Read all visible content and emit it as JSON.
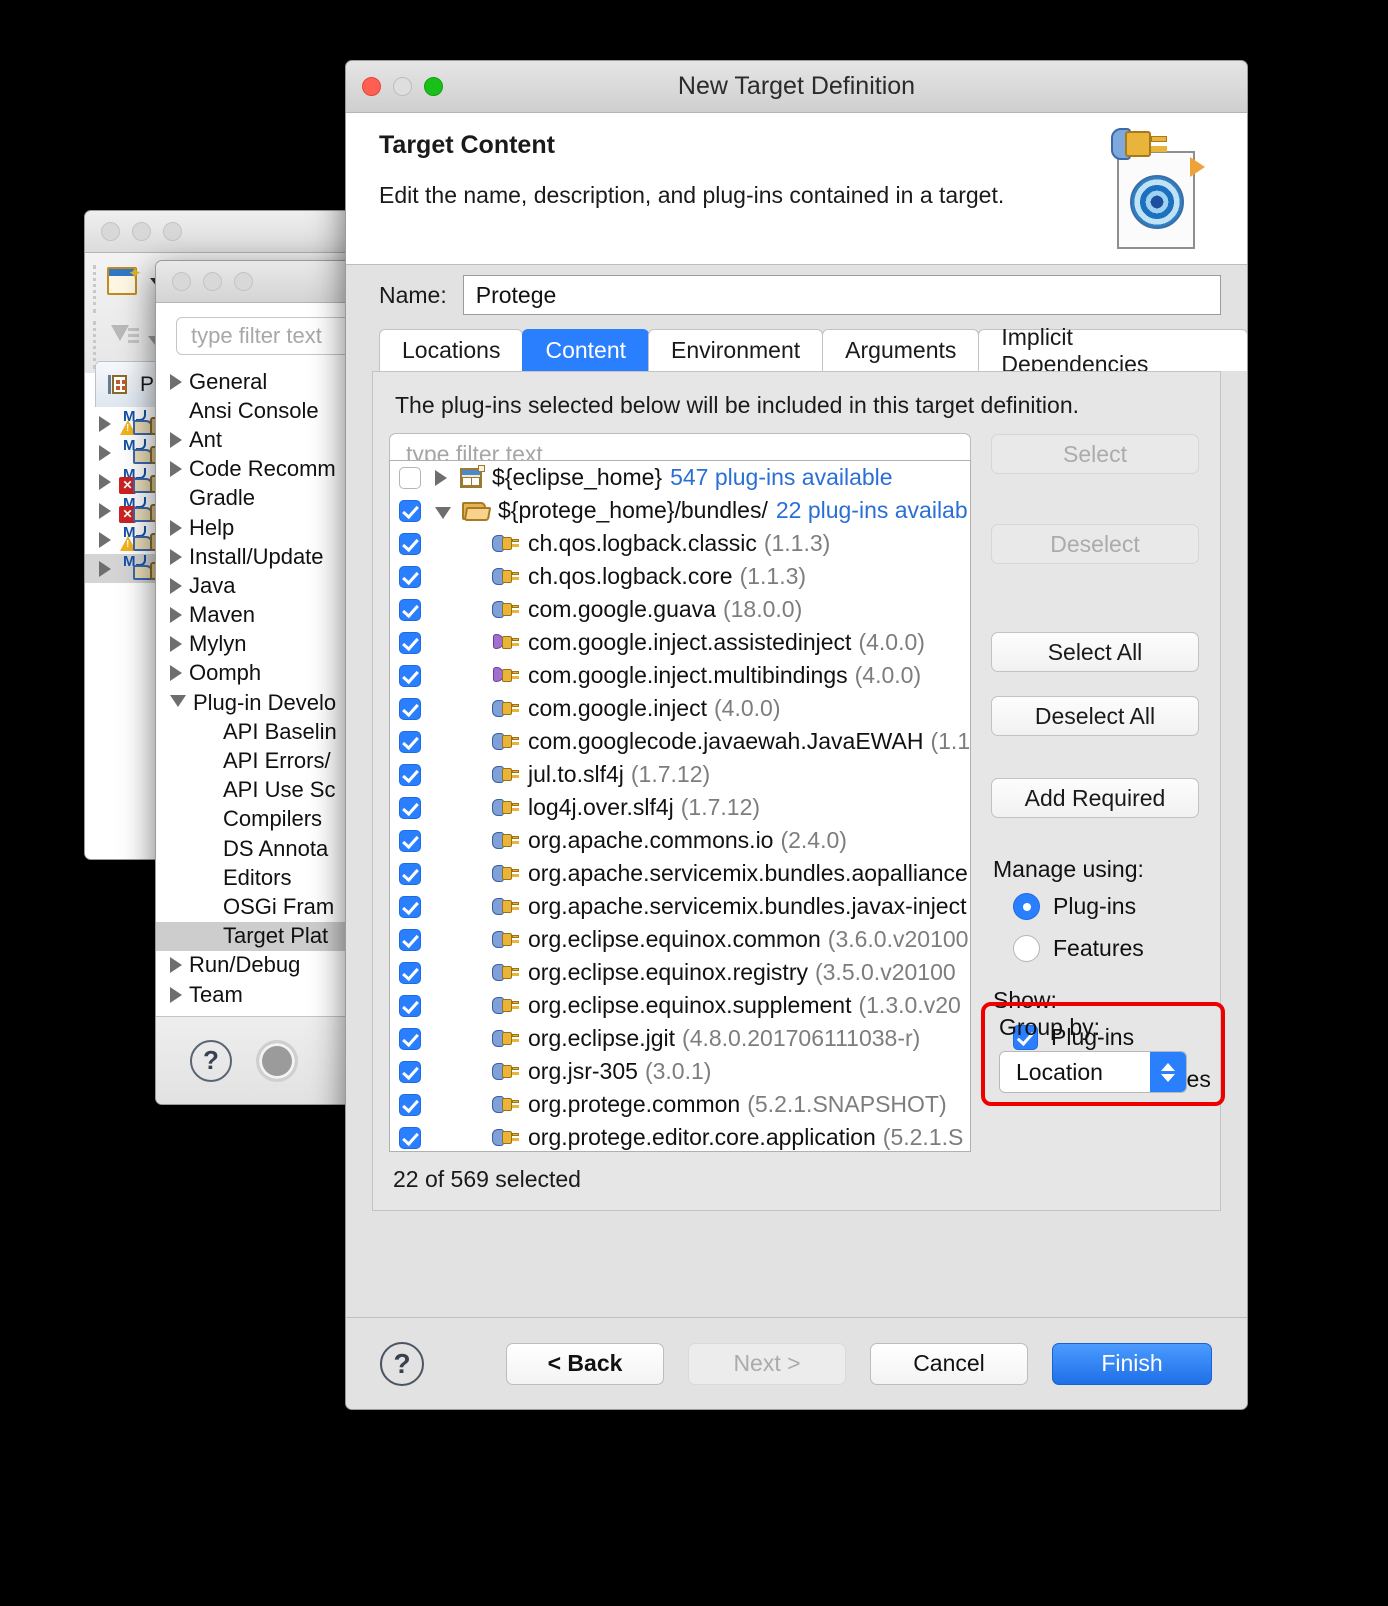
{
  "back_window": {
    "toolbar": {
      "new_icon": "new-wizard-icon",
      "import_icon": "import-icon"
    },
    "tab_label": "Pa",
    "tree_rows": [
      {
        "badge": "warn"
      },
      {
        "badge": "none"
      },
      {
        "badge": "error"
      },
      {
        "badge": "error"
      },
      {
        "badge": "warn"
      },
      {
        "badge": "none"
      }
    ]
  },
  "preferences": {
    "filter_placeholder": "type filter text",
    "tree": [
      {
        "label": "General",
        "arrow": "closed",
        "indent": 0
      },
      {
        "label": "Ansi Console",
        "arrow": "none",
        "indent": 0
      },
      {
        "label": "Ant",
        "arrow": "closed",
        "indent": 0
      },
      {
        "label": "Code Recomm",
        "arrow": "closed",
        "indent": 0
      },
      {
        "label": "Gradle",
        "arrow": "none",
        "indent": 0
      },
      {
        "label": "Help",
        "arrow": "closed",
        "indent": 0
      },
      {
        "label": "Install/Update",
        "arrow": "closed",
        "indent": 0
      },
      {
        "label": "Java",
        "arrow": "closed",
        "indent": 0
      },
      {
        "label": "Maven",
        "arrow": "closed",
        "indent": 0
      },
      {
        "label": "Mylyn",
        "arrow": "closed",
        "indent": 0
      },
      {
        "label": "Oomph",
        "arrow": "closed",
        "indent": 0
      },
      {
        "label": "Plug-in Develo",
        "arrow": "open",
        "indent": 0
      },
      {
        "label": "API Baselin",
        "arrow": "none",
        "indent": 1
      },
      {
        "label": "API Errors/",
        "arrow": "none",
        "indent": 1
      },
      {
        "label": "API Use Sc",
        "arrow": "none",
        "indent": 1
      },
      {
        "label": "Compilers",
        "arrow": "none",
        "indent": 1
      },
      {
        "label": "DS Annota",
        "arrow": "none",
        "indent": 1
      },
      {
        "label": "Editors",
        "arrow": "none",
        "indent": 1
      },
      {
        "label": "OSGi Fram",
        "arrow": "none",
        "indent": 1
      },
      {
        "label": "Target Plat",
        "arrow": "none",
        "indent": 1,
        "selected": true
      },
      {
        "label": "Run/Debug",
        "arrow": "closed",
        "indent": 0
      },
      {
        "label": "Team",
        "arrow": "closed",
        "indent": 0
      }
    ],
    "help_icon": "help-question-icon",
    "restore_icon": "restore-defaults-icon"
  },
  "dialog": {
    "title": "New Target Definition",
    "heading": "Target Content",
    "subheading": "Edit the name, description, and plug-ins contained in a target.",
    "header_icon": "target-plugin-icon",
    "name_label": "Name:",
    "name_value": "Protege",
    "tabs": [
      {
        "label": "Locations",
        "active": false
      },
      {
        "label": "Content",
        "active": true
      },
      {
        "label": "Environment",
        "active": false
      },
      {
        "label": "Arguments",
        "active": false
      },
      {
        "label": "Implicit Dependencies",
        "active": false
      }
    ],
    "panel_description": "The plug-ins selected below will be included in this target definition.",
    "filter_placeholder": "type filter text",
    "tree": [
      {
        "checked": false,
        "twisty": "closed",
        "icon": "eclipse-home-icon",
        "name": "${eclipse_home}",
        "version": "",
        "available": "547 plug-ins available",
        "indent": 0
      },
      {
        "checked": true,
        "twisty": "open",
        "icon": "folder-icon",
        "name": "${protege_home}/bundles/",
        "version": "",
        "available": "22 plug-ins availab",
        "indent": 0
      },
      {
        "checked": true,
        "twisty": "none",
        "icon": "plugin-icon",
        "name": "ch.qos.logback.classic",
        "version": "(1.1.3)",
        "available": "",
        "indent": 1
      },
      {
        "checked": true,
        "twisty": "none",
        "icon": "plugin-icon",
        "name": "ch.qos.logback.core",
        "version": "(1.1.3)",
        "available": "",
        "indent": 1
      },
      {
        "checked": true,
        "twisty": "none",
        "icon": "plugin-icon",
        "name": "com.google.guava",
        "version": "(18.0.0)",
        "available": "",
        "indent": 1
      },
      {
        "checked": true,
        "twisty": "none",
        "icon": "fragment-icon",
        "name": "com.google.inject.assistedinject",
        "version": "(4.0.0)",
        "available": "",
        "indent": 1
      },
      {
        "checked": true,
        "twisty": "none",
        "icon": "fragment-icon",
        "name": "com.google.inject.multibindings",
        "version": "(4.0.0)",
        "available": "",
        "indent": 1
      },
      {
        "checked": true,
        "twisty": "none",
        "icon": "plugin-icon",
        "name": "com.google.inject",
        "version": "(4.0.0)",
        "available": "",
        "indent": 1
      },
      {
        "checked": true,
        "twisty": "none",
        "icon": "plugin-icon",
        "name": "com.googlecode.javaewah.JavaEWAH",
        "version": "(1.1.",
        "available": "",
        "indent": 1
      },
      {
        "checked": true,
        "twisty": "none",
        "icon": "plugin-icon",
        "name": "jul.to.slf4j",
        "version": "(1.7.12)",
        "available": "",
        "indent": 1
      },
      {
        "checked": true,
        "twisty": "none",
        "icon": "plugin-icon",
        "name": "log4j.over.slf4j",
        "version": "(1.7.12)",
        "available": "",
        "indent": 1
      },
      {
        "checked": true,
        "twisty": "none",
        "icon": "plugin-icon",
        "name": "org.apache.commons.io",
        "version": "(2.4.0)",
        "available": "",
        "indent": 1
      },
      {
        "checked": true,
        "twisty": "none",
        "icon": "plugin-icon",
        "name": "org.apache.servicemix.bundles.aopalliance",
        "version": "",
        "available": "",
        "indent": 1
      },
      {
        "checked": true,
        "twisty": "none",
        "icon": "plugin-icon",
        "name": "org.apache.servicemix.bundles.javax-inject",
        "version": "",
        "available": "",
        "indent": 1
      },
      {
        "checked": true,
        "twisty": "none",
        "icon": "plugin-icon",
        "name": "org.eclipse.equinox.common",
        "version": "(3.6.0.v20100",
        "available": "",
        "indent": 1
      },
      {
        "checked": true,
        "twisty": "none",
        "icon": "plugin-icon",
        "name": "org.eclipse.equinox.registry",
        "version": "(3.5.0.v20100",
        "available": "",
        "indent": 1
      },
      {
        "checked": true,
        "twisty": "none",
        "icon": "plugin-icon",
        "name": "org.eclipse.equinox.supplement",
        "version": "(1.3.0.v20",
        "available": "",
        "indent": 1
      },
      {
        "checked": true,
        "twisty": "none",
        "icon": "plugin-icon",
        "name": "org.eclipse.jgit",
        "version": "(4.8.0.201706111038-r)",
        "available": "",
        "indent": 1
      },
      {
        "checked": true,
        "twisty": "none",
        "icon": "plugin-icon",
        "name": "org.jsr-305",
        "version": "(3.0.1)",
        "available": "",
        "indent": 1
      },
      {
        "checked": true,
        "twisty": "none",
        "icon": "plugin-icon",
        "name": "org.protege.common",
        "version": "(5.2.1.SNAPSHOT)",
        "available": "",
        "indent": 1
      },
      {
        "checked": true,
        "twisty": "none",
        "icon": "plugin-icon",
        "name": "org.protege.editor.core.application",
        "version": "(5.2.1.S",
        "available": "",
        "indent": 1
      }
    ],
    "status": "22 of 569 selected",
    "buttons": {
      "select": "Select",
      "deselect": "Deselect",
      "select_all": "Select All",
      "deselect_all": "Deselect All",
      "add_required": "Add Required"
    },
    "manage_using": {
      "label": "Manage using:",
      "options": [
        {
          "label": "Plug-ins",
          "selected": true
        },
        {
          "label": "Features",
          "selected": false
        }
      ]
    },
    "show": {
      "label": "Show:",
      "options": [
        {
          "label": "Plug-ins",
          "checked": true
        },
        {
          "label": "Source bundles",
          "checked": true
        }
      ]
    },
    "group_by": {
      "label": "Group by:",
      "value": "Location",
      "highlight_color": "#ee0000"
    },
    "footer": {
      "help_icon": "help-question-icon",
      "back": "< Back",
      "next": "Next >",
      "cancel": "Cancel",
      "finish": "Finish"
    }
  },
  "colors": {
    "accent": "#2a7fff",
    "link": "#2a6fd6",
    "highlight": "#ee0000"
  }
}
